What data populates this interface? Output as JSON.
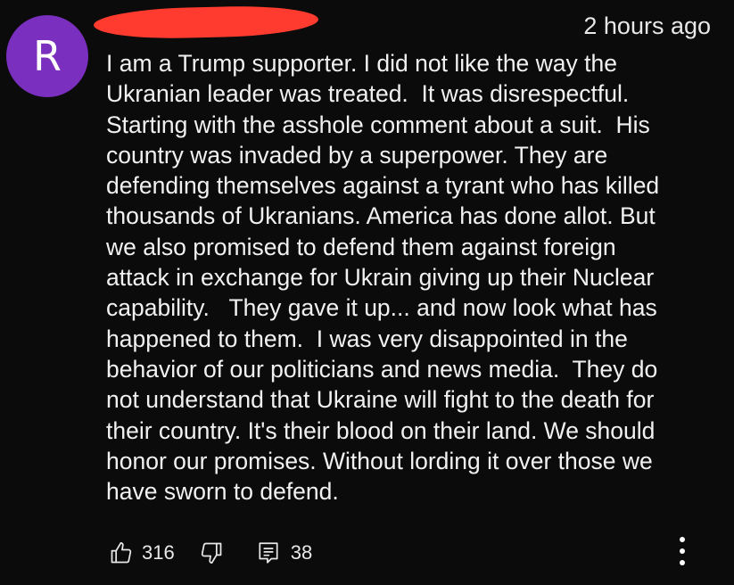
{
  "comment": {
    "avatar_letter": "R",
    "avatar_color": "#7b2fbe",
    "timestamp": "2 hours ago",
    "text_lines": [
      "I am a Trump supporter. I did not like the way the",
      "Ukranian leader was treated.  It was disrespectful.",
      "Starting with the asshole comment about a suit.  His",
      "country was invaded by a superpower. They are",
      "defending themselves against a tyrant who has killed",
      "thousands of Ukranians. America has done allot. But",
      "we also promised to defend them against foreign",
      "attack in exchange for Ukrain giving up their Nuclear",
      "capability.   They gave it up... and now look what has",
      "happened to them.  I was very disappointed in the",
      "behavior of our politicians and news media.  They do",
      "not understand that Ukraine will fight to the death for",
      "their country. It's their blood on their land. We should",
      "honor our promises. Without lording it over those we",
      "have sworn to defend."
    ]
  },
  "actions": {
    "like_icon": "thumbs-up-icon",
    "like_count": "316",
    "dislike_icon": "thumbs-down-icon",
    "reply_icon": "reply-icon",
    "reply_count": "38",
    "more_icon": "more-vertical-icon"
  },
  "colors": {
    "background": "#0b0b0b",
    "text": "#f1f1f1",
    "redaction": "#ff3b2f"
  }
}
